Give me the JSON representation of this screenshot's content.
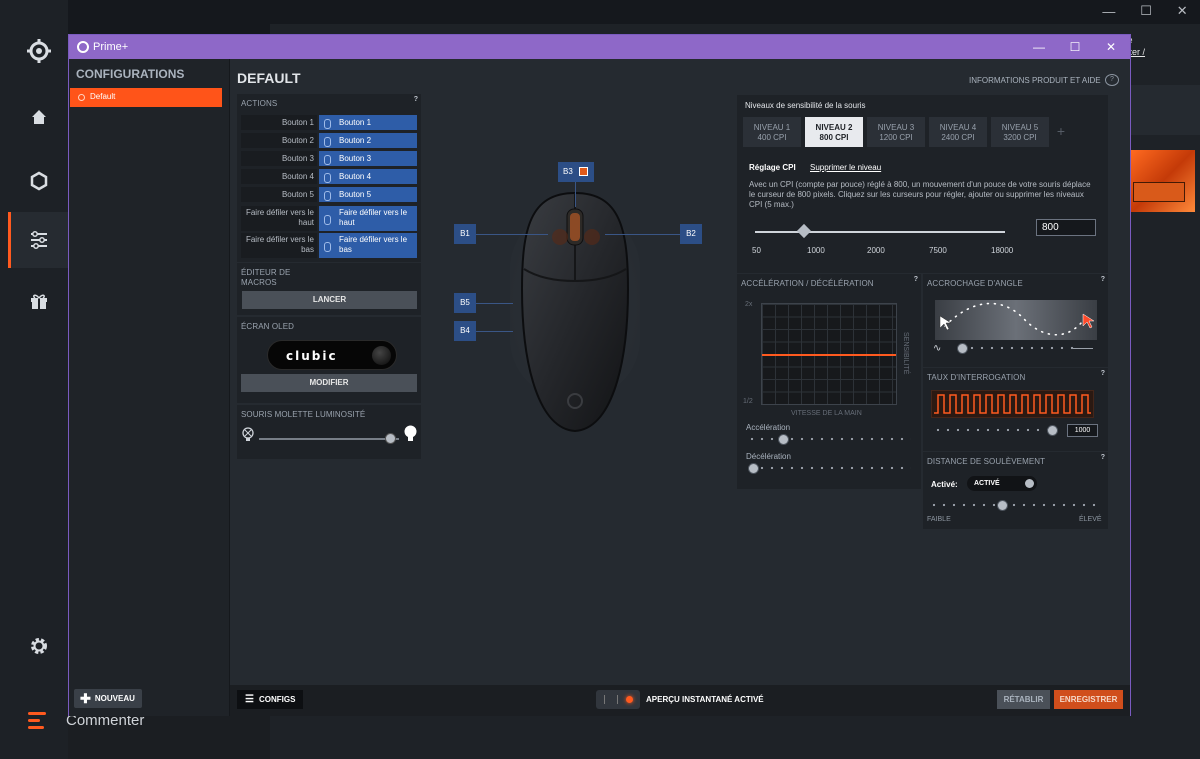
{
  "background_app": {
    "nav_icons": [
      "steelseries-logo-icon",
      "home-icon",
      "hexagon-icon",
      "sliders-icon",
      "gift-icon"
    ],
    "settings_icon": "gear-icon",
    "comment_label": "Commenter",
    "top_right_link_line1": "ete",
    "top_right_link_line2": "ecter /",
    "accent_color": "#ff5a1f"
  },
  "window": {
    "title": "Prime+",
    "titlebar_color": "#8e68c8",
    "minimize": "—",
    "maximize": "☐",
    "close": "✕"
  },
  "configurations": {
    "heading": "CONFIGURATIONS",
    "items": [
      {
        "label": "Default",
        "active": true
      }
    ],
    "new_button": "NOUVEAU"
  },
  "main": {
    "title": "DEFAULT",
    "info_link": "INFORMATIONS PRODUIT ET AIDE"
  },
  "actions": {
    "title": "ACTIONS",
    "help": "?",
    "rows": [
      {
        "label": "Bouton 1",
        "value": "Bouton 1"
      },
      {
        "label": "Bouton 2",
        "value": "Bouton 2"
      },
      {
        "label": "Bouton 3",
        "value": "Bouton 3"
      },
      {
        "label": "Bouton 4",
        "value": "Bouton 4"
      },
      {
        "label": "Bouton 5",
        "value": "Bouton 5"
      },
      {
        "label": "Faire défiler vers le haut",
        "value": "Faire défiler vers le haut"
      },
      {
        "label": "Faire défiler vers le bas",
        "value": "Faire défiler vers le bas"
      }
    ]
  },
  "macros": {
    "title": "ÉDITEUR DE MACROS",
    "button": "LANCER"
  },
  "oled": {
    "title": "ÉCRAN OLED",
    "screen_text": "clubic",
    "button": "MODIFIER"
  },
  "wheel_brightness": {
    "title": "SOURIS MOLETTE LUMINOSITÉ",
    "level": 0.92
  },
  "mouse_buttons": {
    "b1": "B1",
    "b2": "B2",
    "b3": "B3",
    "b4": "B4",
    "b5": "B5"
  },
  "cpi": {
    "title": "Niveaux de sensibilité de la souris",
    "tabs": [
      {
        "line1": "NIVEAU 1",
        "line2": "400 CPI",
        "active": false
      },
      {
        "line1": "NIVEAU 2",
        "line2": "800 CPI",
        "active": true
      },
      {
        "line1": "NIVEAU 3",
        "line2": "1200 CPI",
        "active": false
      },
      {
        "line1": "NIVEAU 4",
        "line2": "2400 CPI",
        "active": false
      },
      {
        "line1": "NIVEAU 5",
        "line2": "3200 CPI",
        "active": false
      }
    ],
    "add": "+",
    "subtab_active": "Réglage CPI",
    "subtab_link": "Supprimer le niveau",
    "description": "Avec un CPI (compte par pouce) réglé à 800, un mouvement d'un pouce de votre souris déplace le curseur de 800 pixels. Cliquez sur les curseurs pour régler, ajouter ou supprimer les niveaux CPI (5 max.)",
    "ticks": [
      "50",
      "1000",
      "2000",
      "7500",
      "18000"
    ],
    "value": "800"
  },
  "acceleration": {
    "title": "ACCÉLÉRATION / DÉCÉLÉRATION",
    "help": "?",
    "y_top": "2x",
    "y_bottom": "1/2",
    "y_label": "SENSIBILITÉ",
    "x_label": "VITESSE DE LA MAIN",
    "accel_label": "Accélération",
    "decel_label": "Décélération",
    "accel_level": 0.25,
    "decel_level": 0.0
  },
  "angle_snapping": {
    "title": "ACCROCHAGE D'ANGLE",
    "help": "?",
    "level": 0.2
  },
  "polling": {
    "title": "TAUX D'INTERROGATION",
    "help": "?",
    "value": "1000"
  },
  "lift_off": {
    "title": "DISTANCE DE SOULÈVEMENT",
    "help": "?",
    "label": "Activé:",
    "toggle": "ACTIVÉ",
    "low": "FAIBLE",
    "high": "ÉLEVÉ",
    "level": 0.45
  },
  "bottom_bar": {
    "configs": "CONFIGS",
    "preview": "APERÇU INSTANTANÉ ACTIVÉ",
    "reset": "RÉTABLIR",
    "save": "ENREGISTRER"
  }
}
